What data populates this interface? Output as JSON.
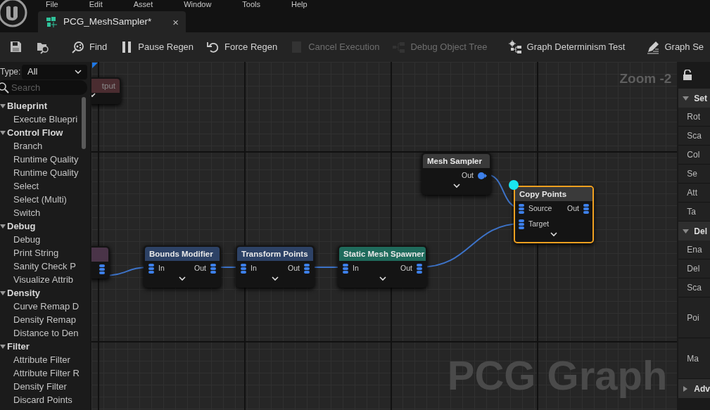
{
  "menu": [
    "File",
    "Edit",
    "Asset",
    "Window",
    "Tools",
    "Help"
  ],
  "tab": {
    "title": "PCG_MeshSampler*",
    "close": "×"
  },
  "toolbar": [
    {
      "kind": "save",
      "disabled": false
    },
    {
      "kind": "browse",
      "disabled": false
    },
    {
      "kind": "find",
      "label": "Find",
      "disabled": false
    },
    {
      "kind": "pause",
      "label": "Pause Regen",
      "disabled": false
    },
    {
      "kind": "regen",
      "label": "Force Regen",
      "disabled": false
    },
    {
      "kind": "cancel",
      "label": "Cancel Execution",
      "disabled": true
    },
    {
      "kind": "tree",
      "label": "Debug Object Tree",
      "disabled": true
    },
    {
      "kind": "determinism",
      "label": "Graph Determinism Test",
      "disabled": false
    },
    {
      "kind": "settings",
      "label": "Graph Se",
      "disabled": false
    }
  ],
  "palette": {
    "type_label": "Type:",
    "type_value": "All",
    "search_placeholder": "Search",
    "categories": [
      {
        "label": "Blueprint",
        "expanded": true,
        "children": [
          {
            "label": "Execute Bluepri"
          }
        ]
      },
      {
        "label": "Control Flow",
        "expanded": true,
        "children": [
          {
            "label": "Branch"
          },
          {
            "label": "Runtime Quality"
          },
          {
            "label": "Runtime Quality"
          },
          {
            "label": "Select"
          },
          {
            "label": "Select (Multi)"
          },
          {
            "label": "Switch"
          }
        ]
      },
      {
        "label": "Debug",
        "expanded": true,
        "children": [
          {
            "label": "Debug"
          },
          {
            "label": "Print String"
          },
          {
            "label": "Sanity Check P"
          },
          {
            "label": "Visualize Attrib"
          }
        ]
      },
      {
        "label": "Density",
        "expanded": true,
        "children": [
          {
            "label": "Curve Remap D"
          },
          {
            "label": "Density Remap"
          },
          {
            "label": "Distance to Den"
          }
        ]
      },
      {
        "label": "Filter",
        "expanded": true,
        "children": [
          {
            "label": "Attribute Filter"
          },
          {
            "label": "Attribute Filter R"
          },
          {
            "label": "Density Filter"
          },
          {
            "label": "Discard Points"
          }
        ]
      }
    ]
  },
  "graph": {
    "zoom": "Zoom -2",
    "title": "PCG Graph",
    "nodes": [
      {
        "title": "tput",
        "color": "#4a2c30",
        "selected": false
      },
      {
        "color": "#4a3448",
        "selected": false,
        "outputs": [
          {
            "kind": "multi"
          }
        ]
      },
      {
        "title": "Bounds Modifier",
        "color": "#2d4266",
        "selected": false,
        "inputs": [
          {
            "label": "In",
            "kind": "multi"
          }
        ],
        "outputs": [
          {
            "label": "Out",
            "kind": "multi"
          }
        ]
      },
      {
        "title": "Transform Points",
        "color": "#2d4266",
        "selected": false,
        "inputs": [
          {
            "label": "In",
            "kind": "multi"
          }
        ],
        "outputs": [
          {
            "label": "Out",
            "kind": "multi"
          }
        ]
      },
      {
        "title": "Static Mesh Spawner",
        "color": "#1f6b5c",
        "selected": false,
        "inputs": [
          {
            "label": "In",
            "kind": "multi"
          }
        ],
        "outputs": [
          {
            "label": "Out",
            "kind": "multi"
          }
        ]
      },
      {
        "title": "Mesh Sampler",
        "color": "#3a3a3a",
        "selected": false,
        "outputs": [
          {
            "label": "Out",
            "kind": "single"
          }
        ]
      },
      {
        "title": "Copy Points",
        "color": "#3a3a3a",
        "selected": true,
        "inputs": [
          {
            "label": "Source",
            "kind": "multi"
          },
          {
            "label": "Target",
            "kind": "multi"
          }
        ],
        "outputs": [
          {
            "label": "Out",
            "kind": "multi"
          }
        ]
      }
    ]
  },
  "details": {
    "sections": [
      {
        "label": "Set",
        "expanded": true,
        "rows": [
          "Rot",
          "Sca",
          "Col",
          "Se",
          "Att",
          "Ta"
        ]
      },
      {
        "label": "Del",
        "expanded": true,
        "rows": [
          "Ena",
          "Del",
          "Sca",
          "Poi",
          "Ma"
        ]
      },
      {
        "label": "Adv",
        "expanded": false
      }
    ]
  }
}
